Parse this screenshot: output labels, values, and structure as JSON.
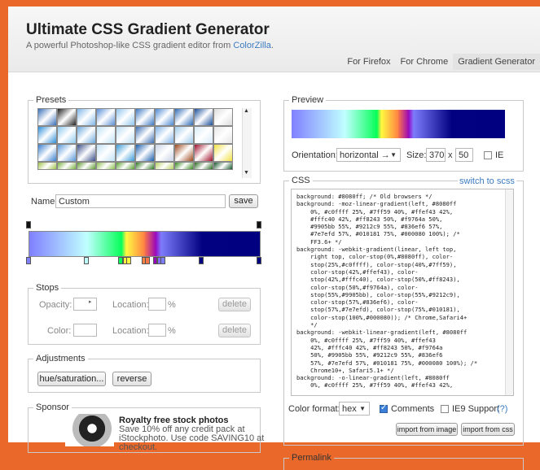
{
  "header": {
    "title": "Ultimate CSS Gradient Generator",
    "subtitle_text": "A powerful Photoshop-like CSS gradient editor from",
    "subtitle_link": "ColorZilla",
    "subtitle_end": "."
  },
  "nav": {
    "tabs": [
      "For Firefox",
      "For Chrome",
      "Gradient Generator"
    ],
    "active": "Gradient Generator"
  },
  "presets": {
    "legend": "Presets",
    "swatches": [
      [
        "#3a6fb8",
        "#222",
        "#7eb6e8",
        "#5a8fd6",
        "#8fc5ee",
        "#3d7ac4",
        "#4d8ad4",
        "#2f6cb8",
        "#1b4f9c",
        "#dcdcdc"
      ],
      [
        "#2f8fd8",
        "#8cc8ee",
        "#6aa8de",
        "#bfe3f6",
        "#b8dcf2",
        "#3d6fb5",
        "#7fb3e6",
        "#9ec9ea",
        "#d6eaf8",
        "#e6e6e6"
      ],
      [
        "#3a7fd0",
        "#5a97da",
        "#3a4f8a",
        "#bfe0f6",
        "#3a9ad8",
        "#1b5fb0",
        "#c8d4e6",
        "#9e4a1e",
        "#a0102a",
        "#f0e040"
      ],
      [
        "#9ec24a",
        "#7ab040",
        "#5f9a30",
        "#8ec050",
        "#5aa030",
        "#2f7a20",
        "#b8d060",
        "#3a8a20",
        "#2a6a20",
        "#1a5a30"
      ]
    ]
  },
  "name_field": {
    "label": "Name:",
    "value": "Custom",
    "save_label": "save"
  },
  "gradient_colors": [
    "#8080ff",
    "#c0ffff",
    "#7ff59",
    "#ffef43",
    "#fffc40",
    "#ff8243",
    "#f9764a",
    "#9905bb",
    "#9212c9",
    "#836ef6",
    "#7e7efd",
    "#010181",
    "#000080"
  ],
  "stops": {
    "legend": "Stops",
    "opacity_label": "Opacity:",
    "location_label": "Location:",
    "percent": "%",
    "color_label": "Color:",
    "delete_label": "delete"
  },
  "adjustments": {
    "legend": "Adjustments",
    "hue_label": "hue/saturation...",
    "reverse_label": "reverse"
  },
  "sponsor": {
    "legend": "Sponsor",
    "title": "Royalty free stock photos",
    "line1": "Save 10% off any credit pack at",
    "line2": "iStockphoto. Use code SAVING10 at",
    "line3": "checkout."
  },
  "preview": {
    "legend": "Preview",
    "orientation_label": "Orientation:",
    "orientation_value": "horizontal →",
    "size_label": "Size:",
    "width": "370",
    "times": "x",
    "height": "50",
    "ie_label": "IE"
  },
  "css": {
    "legend": "CSS",
    "switch_label": "switch to scss",
    "code": "background: #8080ff; /* Old browsers */\nbackground: -moz-linear-gradient(left, #8080ff\n    0%, #c0ffff 25%, #7ff59 40%, #ffef43 42%,\n    #fffc40 42%, #ff8243 50%, #f9764a 50%,\n    #9905bb 55%, #9212c9 55%, #836ef6 57%,\n    #7e7efd 57%, #010181 75%, #000080 100%); /*\n    FF3.6+ */\nbackground: -webkit-gradient(linear, left top,\n    right top, color-stop(0%,#8080ff), color-\n    stop(25%,#c0ffff), color-stop(40%,#7ff59),\n    color-stop(42%,#ffef43), color-\n    stop(42%,#fffc40), color-stop(50%,#ff8243),\n    color-stop(50%,#f9764a), color-\n    stop(55%,#9905bb), color-stop(55%,#9212c9),\n    color-stop(57%,#836ef6), color-\n    stop(57%,#7e7efd), color-stop(75%,#010181),\n    color-stop(100%,#000080)); /* Chrome,Safari4+\n    */\nbackground: -webkit-linear-gradient(left, #8080ff\n    0%, #c0ffff 25%, #7ff59 40%, #ffef43\n    42%, #fffc40 42%, #ff8243 50%, #f9764a\n    50%, #9905bb 55%, #9212c9 55%, #836ef6\n    57%, #7e7efd 57%, #010181 75%, #000080 100%); /*\n    Chrome10+, Safari5.1+ */\nbackground: -o-linear-gradient(left, #8080ff\n    0%, #c0ffff 25%, #7ff59 40%, #ffef43 42%,",
    "format_label": "Color format:",
    "format_value": "hex",
    "comments_label": "Comments",
    "ie9_label": "IE9 Support",
    "help": "(?)",
    "import_image": "import from image",
    "import_css": "import from css"
  },
  "bottom_fieldset": "Permalink"
}
